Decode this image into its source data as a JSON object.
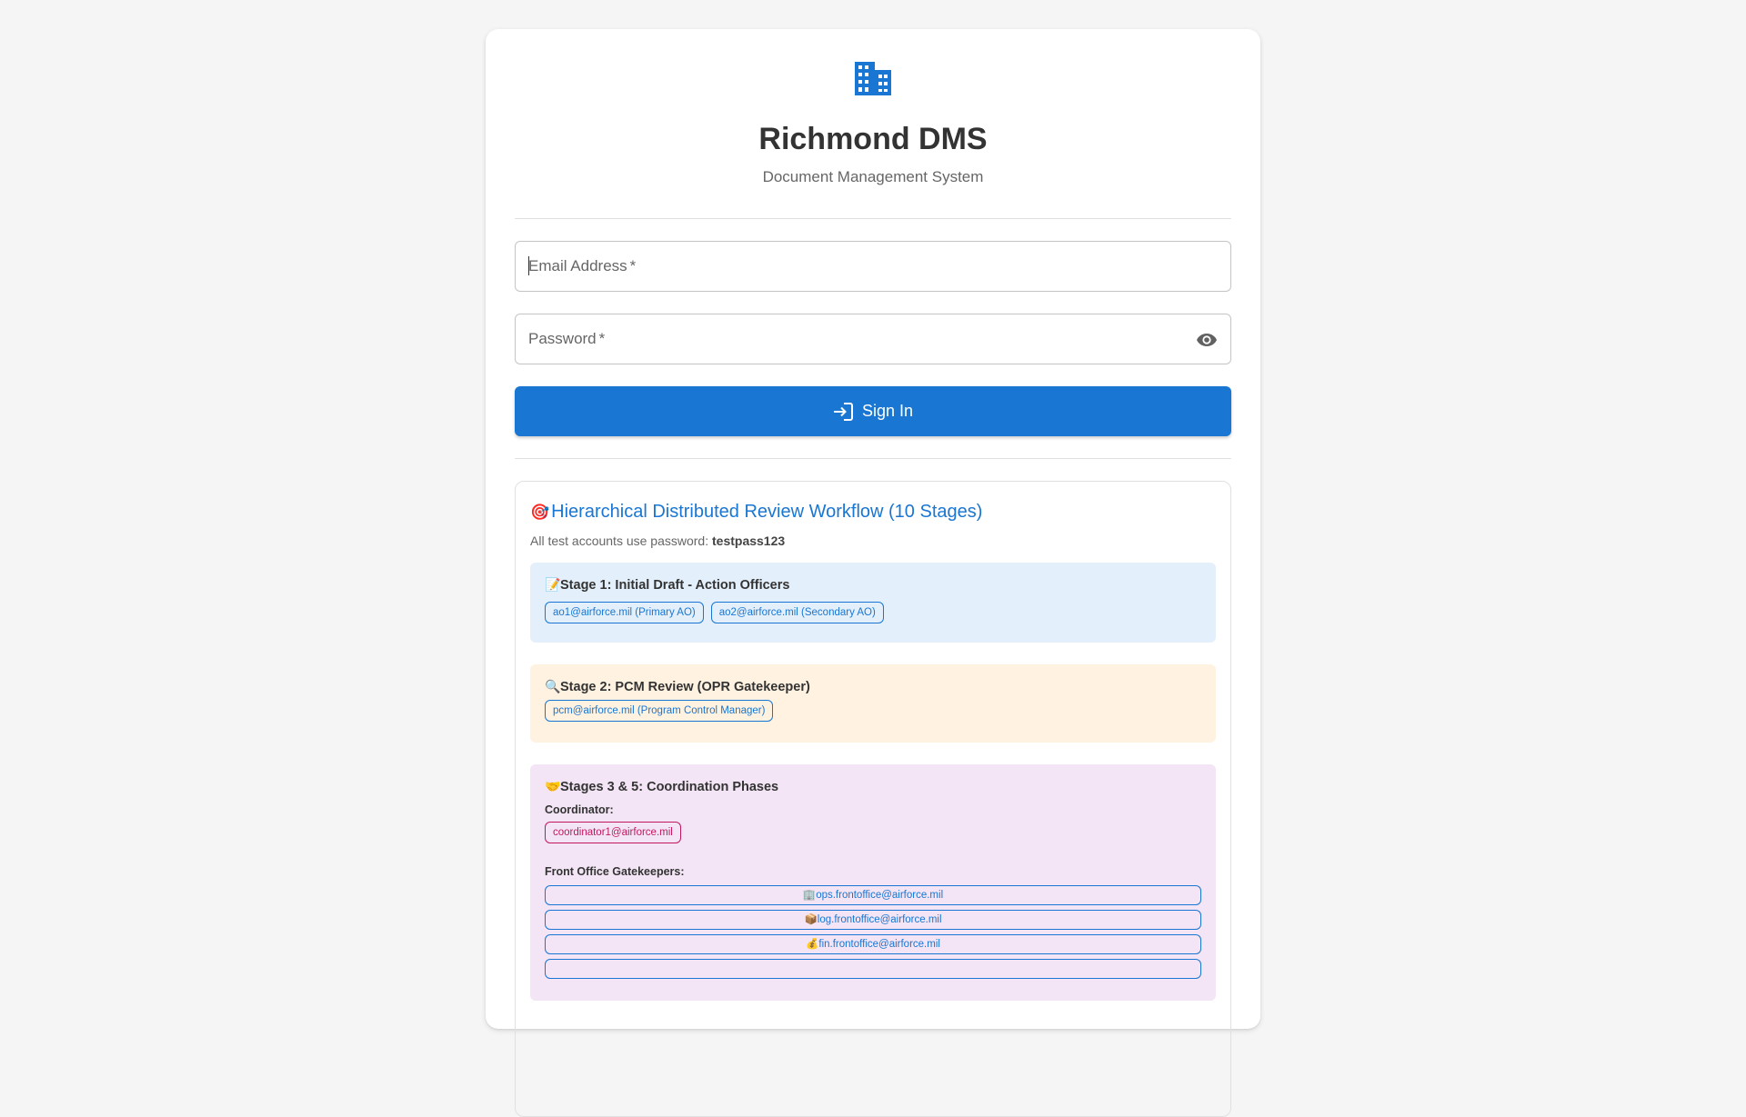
{
  "app": {
    "title": "Richmond DMS",
    "subtitle": "Document Management System",
    "logo_icon": "apartment-icon",
    "accent": "#1976d2"
  },
  "form": {
    "email_label": "Email Address",
    "password_label": "Password",
    "required_mark": "*",
    "signin_label": "Sign In"
  },
  "workflow": {
    "icon": "🎯",
    "title": "Hierarchical Distributed Review Workflow (10 Stages)",
    "note_prefix": "All test accounts use password: ",
    "password": "testpass123",
    "stages": [
      {
        "icon": "📝",
        "title": "Stage 1: Initial Draft - Action Officers",
        "bg": "#e3f0fb",
        "chips": [
          "ao1@airforce.mil (Primary AO)",
          "ao2@airforce.mil (Secondary AO)"
        ]
      },
      {
        "icon": "🔍",
        "title": "Stage 2: PCM Review (OPR Gatekeeper)",
        "bg": "#fff2e0",
        "chips": [
          "pcm@airforce.mil (Program Control Manager)"
        ]
      },
      {
        "icon": "🤝",
        "title": "Stages 3 & 5: Coordination Phases",
        "bg": "#f3e5f5",
        "coordinator_label": "Coordinator:",
        "coordinator_chip": "coordinator1@airforce.mil",
        "gatekeepers_label": "Front Office Gatekeepers:",
        "gatekeepers": [
          {
            "icon": "🏢",
            "email": "ops.frontoffice@airforce.mil"
          },
          {
            "icon": "📦",
            "email": "log.frontoffice@airforce.mil"
          },
          {
            "icon": "💰",
            "email": "fin.frontoffice@airforce.mil"
          }
        ]
      }
    ]
  }
}
